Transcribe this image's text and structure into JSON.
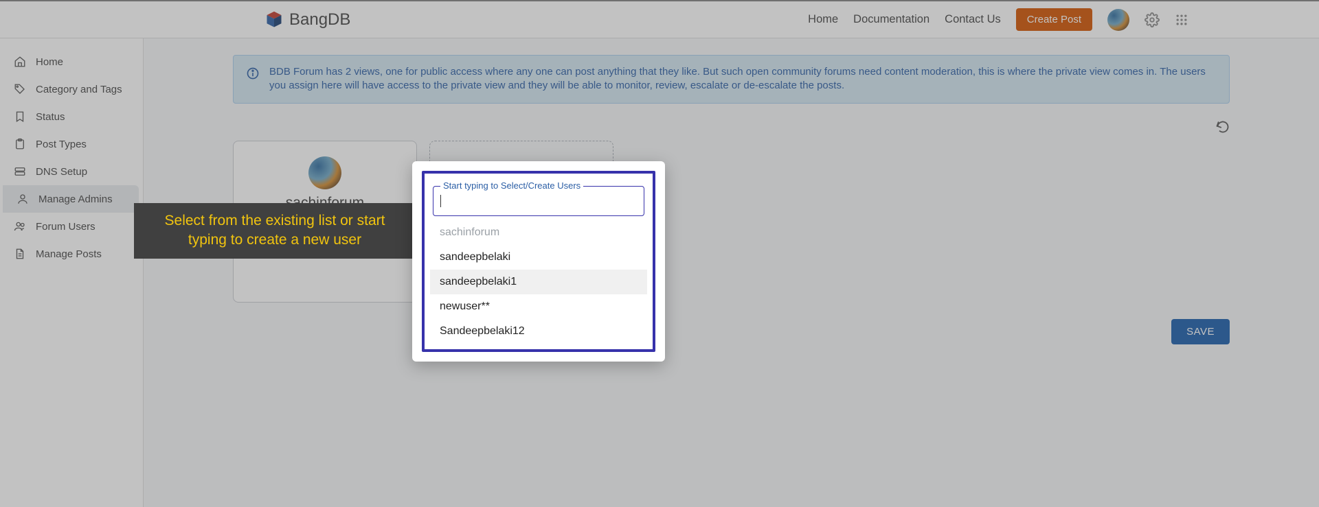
{
  "brand": {
    "name": "BangDB"
  },
  "nav": {
    "home": "Home",
    "docs": "Documentation",
    "contact": "Contact Us",
    "create_post": "Create Post"
  },
  "sidebar": {
    "items": [
      {
        "label": "Home",
        "icon": "home"
      },
      {
        "label": "Category and Tags",
        "icon": "tag"
      },
      {
        "label": "Status",
        "icon": "bookmark"
      },
      {
        "label": "Post Types",
        "icon": "clipboard"
      },
      {
        "label": "DNS Setup",
        "icon": "server"
      },
      {
        "label": "Manage Admins",
        "icon": "user"
      },
      {
        "label": "Forum Users",
        "icon": "users"
      },
      {
        "label": "Manage Posts",
        "icon": "file"
      }
    ],
    "active_index": 5
  },
  "info_banner": "BDB Forum has 2 views, one for public access where any one can post anything that they like. But such open community forums need content moderation, this is where the private view comes in. The users you assign here will have access to the private view and they will be able to monitor, review, escalate or de-escalate the posts.",
  "existing_admins": [
    {
      "name": "sachinforum"
    }
  ],
  "save_label": "SAVE",
  "tooltip": "Select from the existing list or start typing to create a new user",
  "dropdown": {
    "label": "Start typing to Select/Create Users",
    "value": "",
    "options": [
      {
        "label": "sachinforum",
        "state": "selected"
      },
      {
        "label": "sandeepbelaki",
        "state": ""
      },
      {
        "label": "sandeepbelaki1",
        "state": "hover"
      },
      {
        "label": "newuser**",
        "state": ""
      },
      {
        "label": "Sandeepbelaki12",
        "state": ""
      }
    ]
  }
}
